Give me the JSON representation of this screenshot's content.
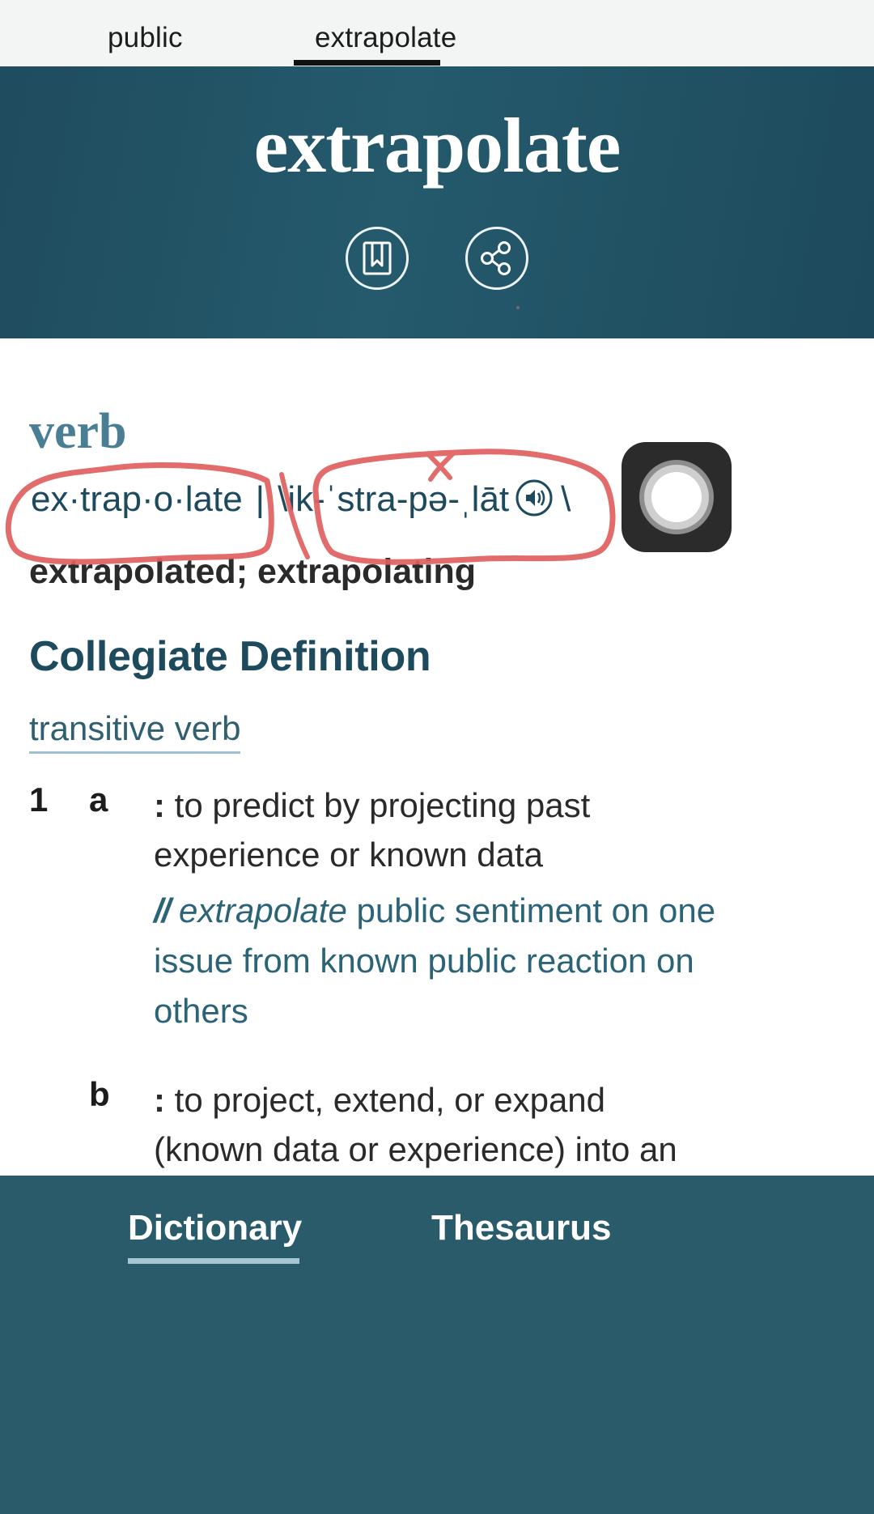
{
  "tabs": {
    "items": [
      {
        "label": "public",
        "active": false
      },
      {
        "label": "extrapolate",
        "active": true
      }
    ]
  },
  "hero": {
    "word": "extrapolate",
    "bg_color": "#1f4c5e",
    "actions": [
      {
        "name": "bookmark-icon",
        "label": "Save"
      },
      {
        "name": "share-icon",
        "label": "Share"
      }
    ]
  },
  "entry": {
    "part_of_speech": "verb",
    "part_of_speech_color": "#4a7e95",
    "syllabification": "ex·trap·o·late",
    "separator": "|",
    "pronunciation_open": "\\",
    "pronunciation": "ik-ˈstra-pə-ˌlāt",
    "pronunciation_close": "\\",
    "audio_icon": "speaker-icon",
    "inflections": "extrapolated; extrapolating",
    "inflections_first": "extrapolated",
    "inflections_semicolon": ";",
    "inflections_second": "extrapolating"
  },
  "definition": {
    "section_title": "Collegiate Definition",
    "functional_label": "transitive verb",
    "senses": [
      {
        "number": "1",
        "letter": "a",
        "colon": ":",
        "text": "to predict by projecting past experience or known data",
        "example": {
          "marker": "//",
          "italic_word": "extrapolate",
          "rest": " public sentiment on one issue from known public reaction on others"
        }
      },
      {
        "number": "",
        "letter": "b",
        "colon": ":",
        "text": "to project, extend, or expand (known data or experience) into an area not known or"
      }
    ]
  },
  "bottom_nav": {
    "items": [
      {
        "label": "Dictionary",
        "active": true
      },
      {
        "label": "Thesaurus",
        "active": false
      }
    ],
    "bg_color": "#2a5b6b",
    "active_underline_color": "#a7c6d2"
  },
  "annotations": {
    "color": "#e06060",
    "shapes": [
      "circle-around-syllabification",
      "circle-around-pronunciation"
    ]
  },
  "overlay": {
    "name": "screen-recording-indicator",
    "bg_color": "#2b2b2b"
  }
}
